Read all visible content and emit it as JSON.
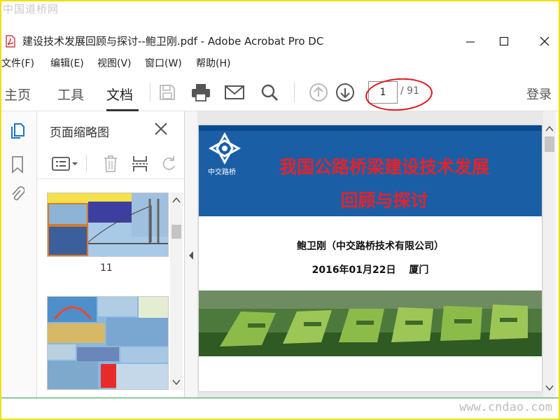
{
  "watermark_top": "中国道桥网",
  "watermark_bottom": "www.cndao.com",
  "window": {
    "title": "建设技术发展回顾与探讨--鲍卫刚.pdf - Adobe Acrobat Pro DC",
    "icon": "pdf-file-icon",
    "minimize": "—",
    "maximize": "☐",
    "close": "✕"
  },
  "menu": [
    "文件(F)",
    "编辑(E)",
    "视图(V)",
    "窗口(W)",
    "帮助(H)"
  ],
  "tabs": [
    "主页",
    "工具",
    "文档"
  ],
  "active_tab": "文档",
  "toolbar": {
    "icons": [
      "save-icon",
      "print-icon",
      "email-icon",
      "search-icon",
      "previous-page-icon",
      "next-page-icon"
    ],
    "page_current": "1",
    "page_total": "/ 91",
    "login": "登录"
  },
  "colors": {
    "highlight": "#e0141b",
    "doc_title": "#e3232a",
    "banner": "#1a5fa6",
    "accent_line": "#2a9a45"
  },
  "sidebar": {
    "rail_icons": [
      "page-thumbnails-icon",
      "bookmark-icon",
      "attachment-icon"
    ],
    "panel_title": "页面缩略图",
    "tools": [
      "thumbnail-options-icon",
      "delete-icon",
      "extract-icon",
      "rotate-icon"
    ],
    "thumbnails": [
      {
        "label": "11"
      },
      {
        "label": ""
      }
    ]
  },
  "document": {
    "logo_text": "中交路桥",
    "title_line1": "我国公路桥梁建设技术发展",
    "title_line2": "回顾与探讨",
    "author": "鲍卫刚（中交路桥技术有限公司）",
    "date_place": "2016年01月22日　 厦门"
  }
}
